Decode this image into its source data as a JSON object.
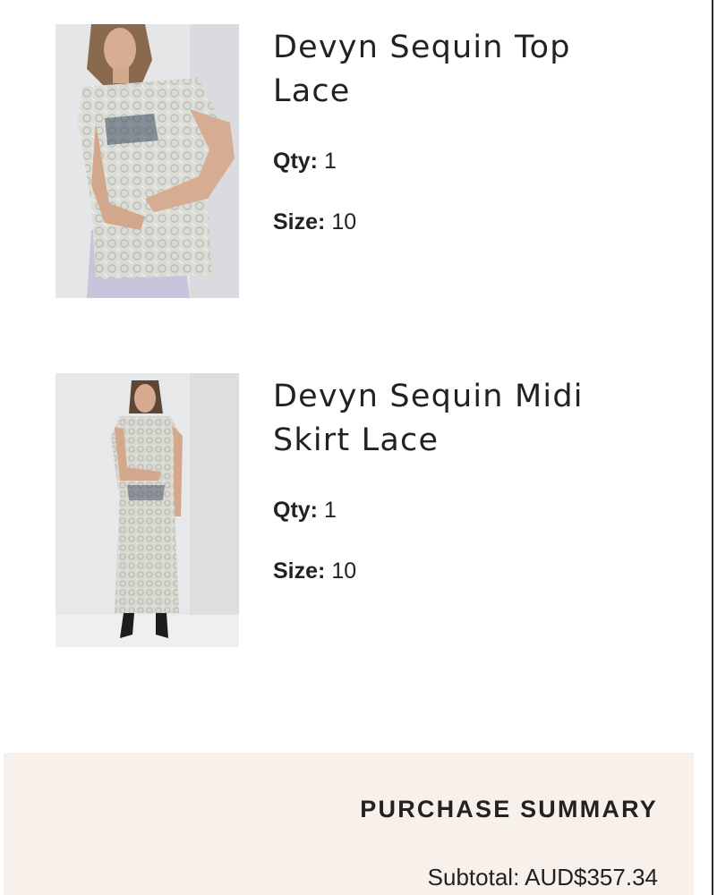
{
  "cart_items": [
    {
      "name_line1": "Devyn Sequin Top",
      "name_line2": "Lace",
      "qty_label": "Qty:",
      "qty_value": "1",
      "size_label": "Size:",
      "size_value": "10",
      "image_alt": "Model wearing sequin lace top"
    },
    {
      "name_line1": "Devyn Sequin Midi",
      "name_line2": "Skirt Lace",
      "qty_label": "Qty:",
      "qty_value": "1",
      "size_label": "Size:",
      "size_value": "10",
      "image_alt": "Model wearing sequin lace midi skirt set"
    }
  ],
  "summary": {
    "title": "PURCHASE SUMMARY",
    "subtotal_label": "Subtotal:",
    "subtotal_value": "AUD$357.34"
  },
  "colors": {
    "summary_bg": "#f8f0ea",
    "text": "#222222",
    "photo_bg": "#e7e8ea"
  }
}
